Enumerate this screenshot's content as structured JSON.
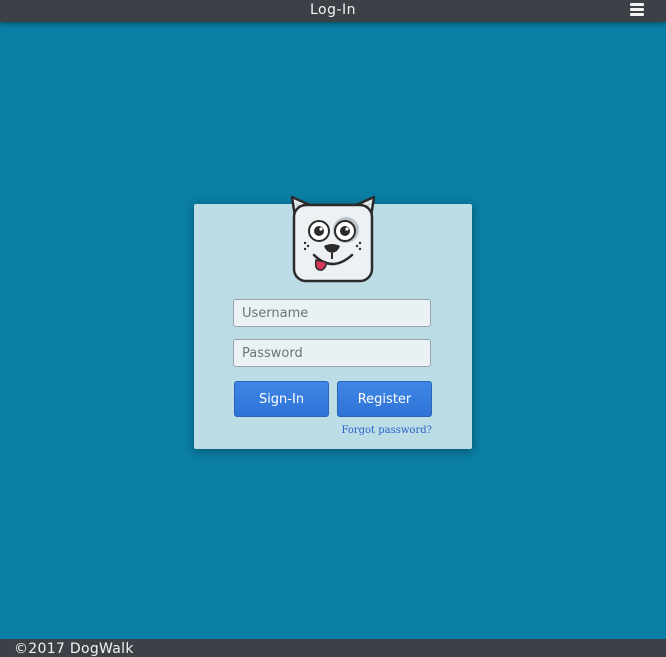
{
  "header": {
    "title": "Log-In",
    "menu_icon": "hamburger-menu-icon"
  },
  "logo": {
    "icon": "dog-face-logo-icon"
  },
  "form": {
    "username_placeholder": "Username",
    "username_value": "",
    "password_placeholder": "Password",
    "password_value": "",
    "signin_label": "Sign-In",
    "register_label": "Register",
    "forgot_label": "Forgot password?"
  },
  "footer": {
    "text": "©2017 DogWalk"
  },
  "colors": {
    "background": "#0a7ea4",
    "bar": "#3b4146",
    "card": "#bcdde6",
    "button": "#3a80e0",
    "link": "#2a62c9"
  }
}
